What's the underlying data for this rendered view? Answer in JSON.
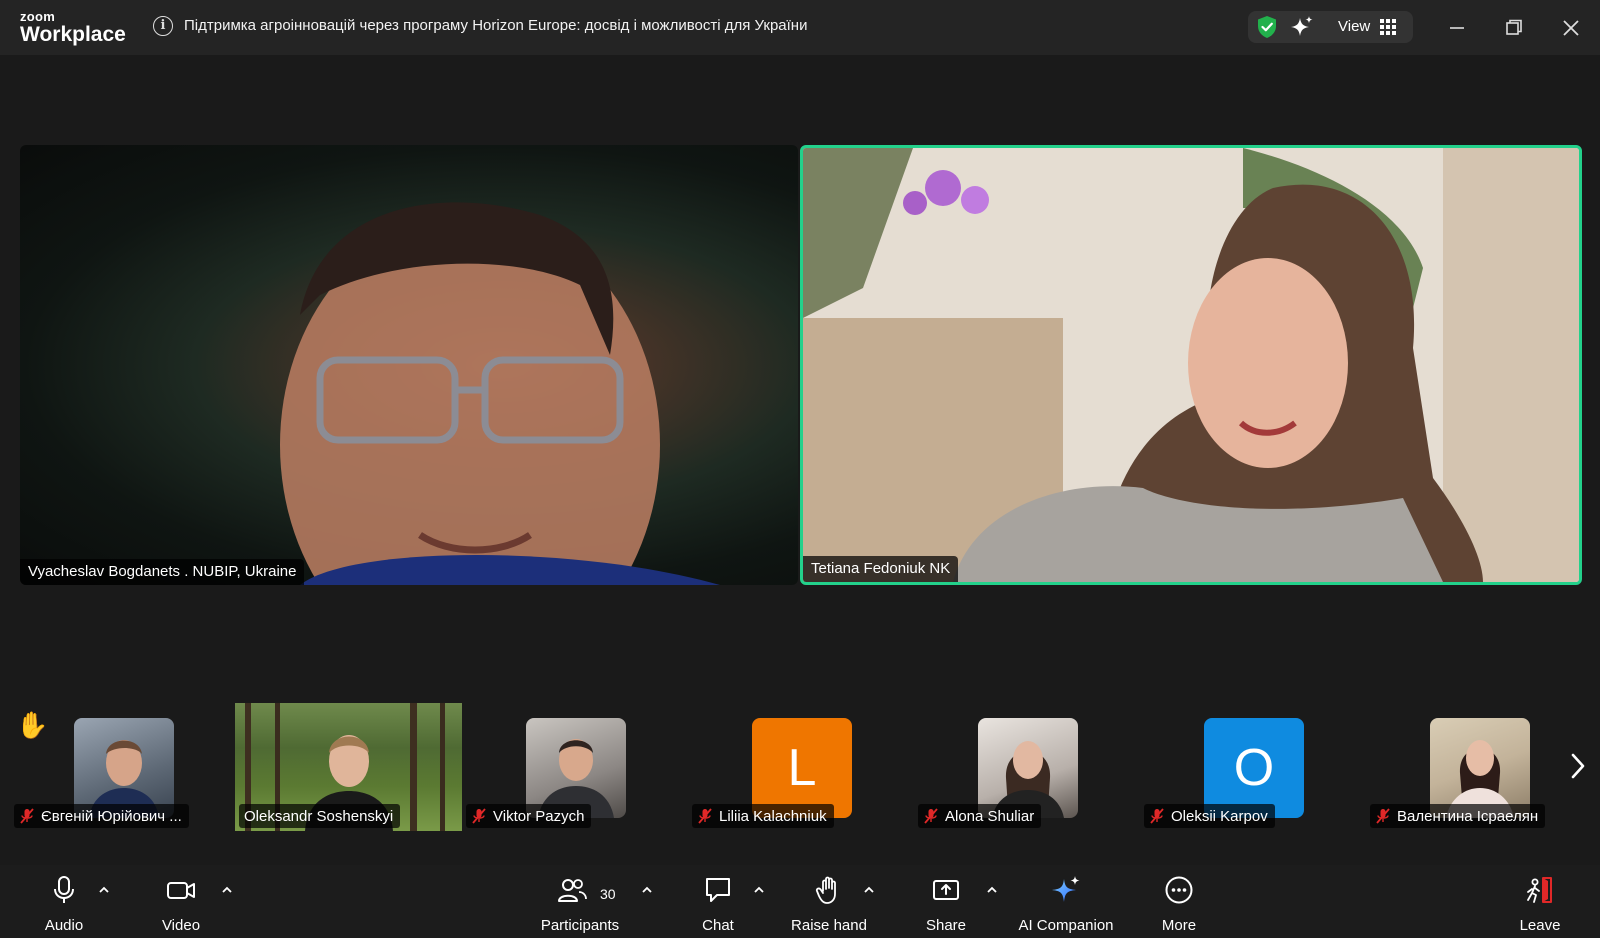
{
  "app": {
    "brand_small": "zoom",
    "brand_big": "Workplace"
  },
  "meeting": {
    "title": "Підтримка агроінновацій через програму Horizon Europe: досвід і можливості для України"
  },
  "header": {
    "view_label": "View"
  },
  "speakers": [
    {
      "name": "Vyacheslav Bogdanets . NUBIP, Ukraine"
    },
    {
      "name": "Tetiana Fedoniuk NK"
    }
  ],
  "participants_strip": [
    {
      "name": "Євгеній Юрійович ...",
      "muted": true,
      "avatar": "photo"
    },
    {
      "name": "Oleksandr Soshenskyi",
      "muted": false,
      "avatar": "video"
    },
    {
      "name": "Viktor Pazych",
      "muted": true,
      "avatar": "photo"
    },
    {
      "name": "Liliia Kalachniuk",
      "muted": true,
      "avatar": "letter",
      "letter": "L",
      "color": "#ef7600"
    },
    {
      "name": "Alona Shuliar",
      "muted": true,
      "avatar": "photo"
    },
    {
      "name": "Oleksii Karpov",
      "muted": true,
      "avatar": "letter",
      "letter": "O",
      "color": "#0f8be0"
    },
    {
      "name": "Валентина Ісраелян",
      "muted": true,
      "avatar": "photo"
    }
  ],
  "toolbar": {
    "audio": "Audio",
    "video": "Video",
    "participants": "Participants",
    "participants_count": "30",
    "chat": "Chat",
    "raise_hand": "Raise hand",
    "share": "Share",
    "ai_companion": "AI Companion",
    "more": "More",
    "leave": "Leave"
  },
  "colors": {
    "active_speaker_border": "#23d18b",
    "mute_red": "#e02828",
    "shield_green": "#22b14c"
  },
  "icons": [
    "info-icon",
    "shield-icon",
    "sparkle-icon",
    "grid-icon",
    "minimize-icon",
    "restore-icon",
    "close-icon",
    "raise-hand-emoji-icon",
    "mic-muted-icon",
    "chevron-right-icon",
    "microphone-icon",
    "camera-icon",
    "participants-icon",
    "chat-icon",
    "hand-icon",
    "share-icon",
    "more-icon",
    "leave-icon"
  ]
}
